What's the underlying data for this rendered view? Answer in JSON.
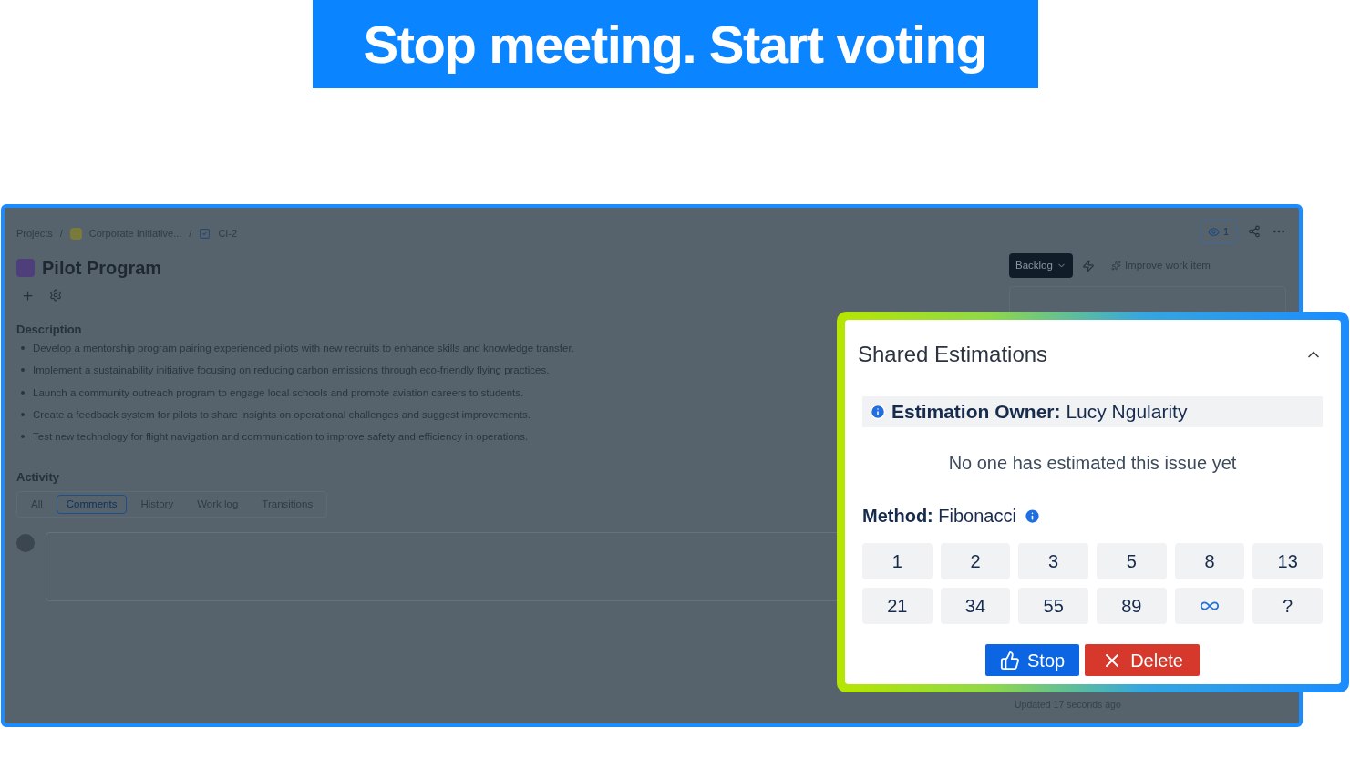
{
  "headline": "Stop meeting. Start voting",
  "breadcrumbs": [
    {
      "label": "Projects",
      "kind": "text"
    },
    {
      "label": "Corporate Initiative...",
      "kind": "project"
    },
    {
      "label": "CI-2",
      "kind": "issue"
    }
  ],
  "breadcrumb_separators": [
    "/",
    "/"
  ],
  "issue": {
    "title": "Pilot Program"
  },
  "header_actions": {
    "watchers": "1"
  },
  "status": {
    "label": "Backlog"
  },
  "improve_button": "Improve work item",
  "description": {
    "heading": "Description",
    "items": [
      "Develop a mentorship program pairing experienced pilots with new recruits to enhance skills and knowledge transfer.",
      "Implement a sustainability initiative focusing on reducing carbon emissions through eco-friendly flying practices.",
      "Launch a community outreach program to engage local schools and promote aviation careers to students.",
      "Create a feedback system for pilots to share insights on operational challenges and suggest improvements.",
      "Test new technology for flight navigation and communication to improve safety and efficiency in operations."
    ]
  },
  "activity": {
    "heading": "Activity",
    "tabs": [
      {
        "label": "All",
        "selected": false
      },
      {
        "label": "Comments",
        "selected": true
      },
      {
        "label": "History",
        "selected": false
      },
      {
        "label": "Work log",
        "selected": false
      },
      {
        "label": "Transitions",
        "selected": false
      }
    ]
  },
  "updated": "Updated 17 seconds ago",
  "estimations": {
    "title": "Shared Estimations",
    "expanded": true,
    "owner_label": "Estimation Owner:",
    "owner": "Lucy Ngularity",
    "empty_message": "No one has estimated this issue yet",
    "method_label": "Method:",
    "method": "Fibonacci",
    "cards": [
      {
        "kind": "number",
        "label": "1"
      },
      {
        "kind": "number",
        "label": "2"
      },
      {
        "kind": "number",
        "label": "3"
      },
      {
        "kind": "number",
        "label": "5"
      },
      {
        "kind": "number",
        "label": "8"
      },
      {
        "kind": "number",
        "label": "13"
      },
      {
        "kind": "number",
        "label": "21"
      },
      {
        "kind": "number",
        "label": "34"
      },
      {
        "kind": "number",
        "label": "55"
      },
      {
        "kind": "number",
        "label": "89"
      },
      {
        "kind": "infinity"
      },
      {
        "kind": "number",
        "label": "?"
      }
    ],
    "stop_button": "Stop",
    "delete_button": "Delete"
  }
}
